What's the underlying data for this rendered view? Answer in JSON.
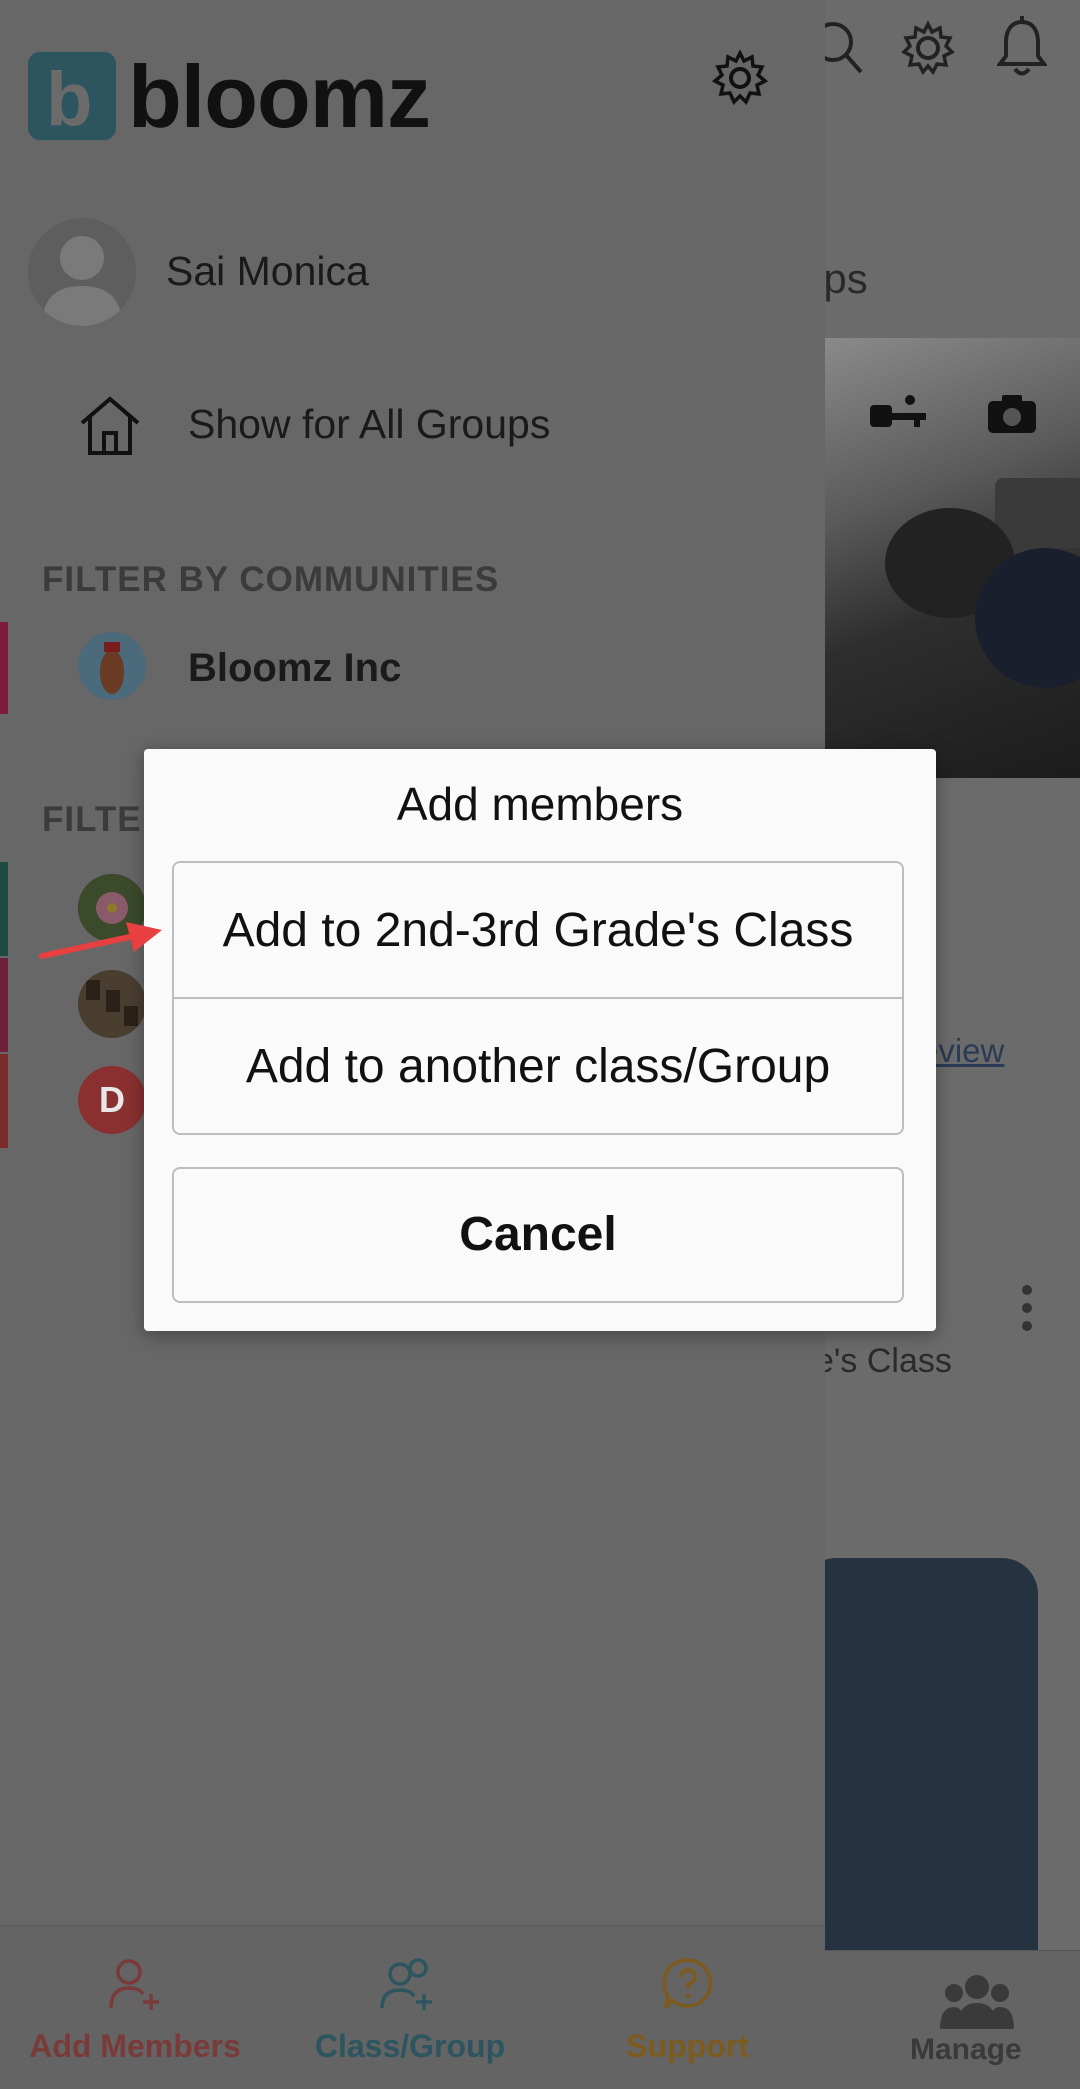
{
  "background": {
    "header_title_fragment": "ups",
    "preview_link_fragment": "eview",
    "class_name_fragment": "e's Class",
    "manage_label": "Manage"
  },
  "drawer": {
    "logo_text": "bloomz",
    "user_name": "Sai Monica",
    "show_all_label": "Show for All Groups",
    "communities_header": "FILTER BY COMMUNITIES",
    "community_name": "Bloomz Inc",
    "groups_header_fragment": "FILTE",
    "group_d_letter": "D"
  },
  "dialog": {
    "title": "Add members",
    "option_current_class": "Add to 2nd-3rd Grade's Class",
    "option_another": "Add to another class/Group",
    "cancel": "Cancel"
  },
  "bottom_nav": {
    "add_members": "Add Members",
    "class_group": "Class/Group",
    "support": "Support"
  },
  "colors": {
    "add_members": "#7a3a3a",
    "class_group": "#2c5560",
    "support": "#7d5a1e",
    "community_bar": "#7a1c3c",
    "group_bar_1": "#1e4a44",
    "group_bar_2": "#6e1f3a",
    "group_bar_3": "#7a2a2a",
    "annotation_arrow": "#e84040"
  },
  "icons": {
    "bg_search": "search-icon",
    "bg_settings": "gear-icon",
    "bg_notifications": "bell-icon",
    "drawer_settings": "gear-icon",
    "home": "home-icon",
    "camera": "camera-icon",
    "key": "key-icon"
  }
}
